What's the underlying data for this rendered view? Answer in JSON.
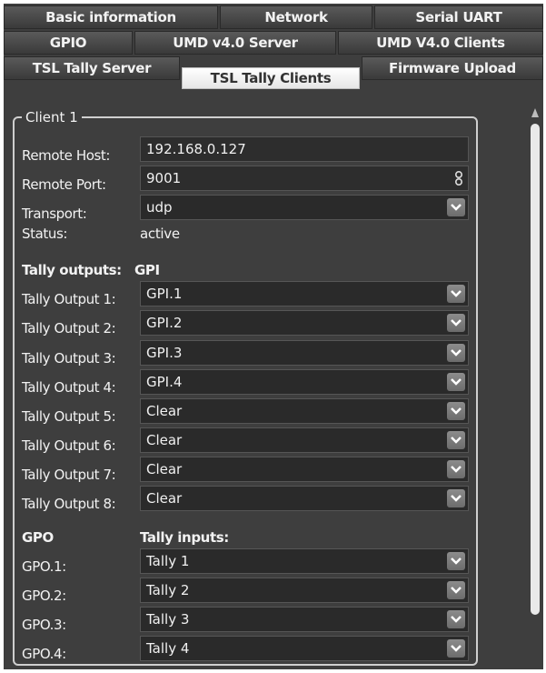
{
  "tabs": {
    "row1": [
      "Basic information",
      "Network",
      "Serial UART"
    ],
    "row2": [
      "GPIO",
      "UMD v4.0 Server",
      "UMD V4.0 Clients"
    ],
    "row3": [
      "TSL Tally Server",
      "TSL Tally Clients",
      "Firmware Upload"
    ],
    "selected": "TSL Tally Clients"
  },
  "client": {
    "title": "Client 1",
    "remote_host_label": "Remote Host:",
    "remote_host_value": "192.168.0.127",
    "remote_port_label": "Remote Port:",
    "remote_port_value": "9001",
    "transport_label": "Transport:",
    "transport_value": "udp",
    "status_label": "Status:",
    "status_value": "active",
    "tally_outputs_heading": "Tally outputs:",
    "gpi_heading": "GPI",
    "outputs": [
      {
        "label": "Tally Output 1:",
        "value": "GPI.1"
      },
      {
        "label": "Tally Output 2:",
        "value": "GPI.2"
      },
      {
        "label": "Tally Output 3:",
        "value": "GPI.3"
      },
      {
        "label": "Tally Output 4:",
        "value": "GPI.4"
      },
      {
        "label": "Tally Output 5:",
        "value": "Clear"
      },
      {
        "label": "Tally Output 6:",
        "value": "Clear"
      },
      {
        "label": "Tally Output 7:",
        "value": "Clear"
      },
      {
        "label": "Tally Output 8:",
        "value": "Clear"
      }
    ],
    "gpo_heading": "GPO",
    "tally_inputs_heading": "Tally inputs:",
    "gpos": [
      {
        "label": "GPO.1:",
        "value": "Tally 1"
      },
      {
        "label": "GPO.2:",
        "value": "Tally 2"
      },
      {
        "label": "GPO.3:",
        "value": "Tally 3"
      },
      {
        "label": "GPO.4:",
        "value": "Tally 4"
      }
    ]
  },
  "icons": {
    "combo_arrow": "chevron-down-icon",
    "port_spinner": "spinner-icon",
    "scroll_up": "scroll-up-icon"
  },
  "colors": {
    "background": "#3e3e3e",
    "selected_tab": "#ffffff",
    "text": "#f2f2f2"
  }
}
